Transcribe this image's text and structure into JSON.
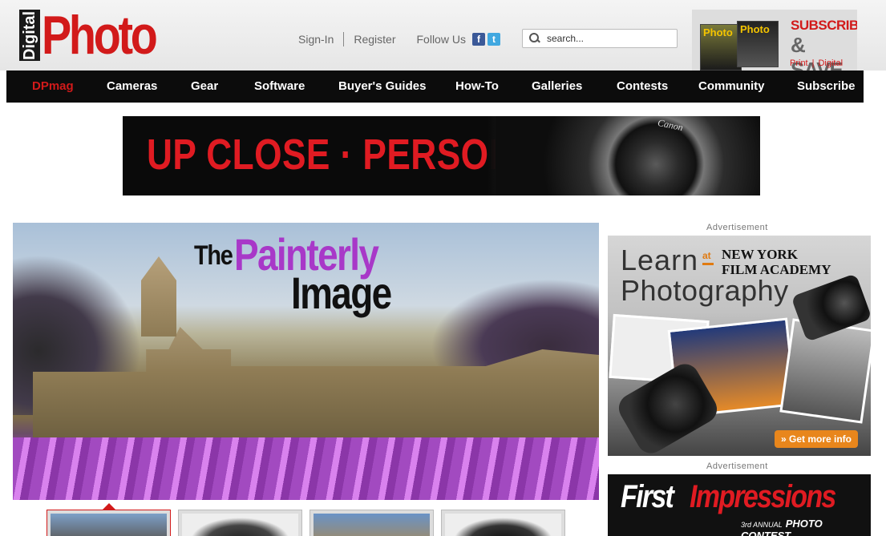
{
  "header": {
    "logo_small": "Digital",
    "logo_big": "Photo",
    "signin": "Sign-In",
    "register": "Register",
    "follow": "Follow Us",
    "facebook_glyph": "f",
    "twitter_glyph": "t",
    "search_placeholder": "search...",
    "subscribe": {
      "line1": "SUBSCRIBE",
      "line2": "& SAVE",
      "print": "Print",
      "sep": "|",
      "digital": "Digital",
      "mag_label": "Photo"
    }
  },
  "nav": {
    "items": [
      "DPmag",
      "Cameras",
      "Gear",
      "Software",
      "Buyer's Guides",
      "How-To",
      "Galleries",
      "Contests",
      "Community",
      "Subscribe"
    ]
  },
  "banner": {
    "headline": "UP CLOSE · PERSONAL",
    "brand": "Canon"
  },
  "hero": {
    "the": "The",
    "painterly": "Painterly",
    "image": "Image"
  },
  "sidebar": {
    "ad_label": "Advertisement",
    "ad1": {
      "learn": "Learn",
      "at": "at",
      "school1": "NEW YORK",
      "school2": "FILM ACADEMY",
      "subject": "Photography",
      "cta": "» Get more info"
    },
    "ad2": {
      "first": "First",
      "impressions": "Impressions",
      "annual": "3rd ANNUAL",
      "contest": "PHOTO CONTEST"
    }
  },
  "colors": {
    "brand_red": "#d21a1a",
    "nav_bg": "#0c0c0c",
    "painterly_purple": "#a838c8"
  }
}
